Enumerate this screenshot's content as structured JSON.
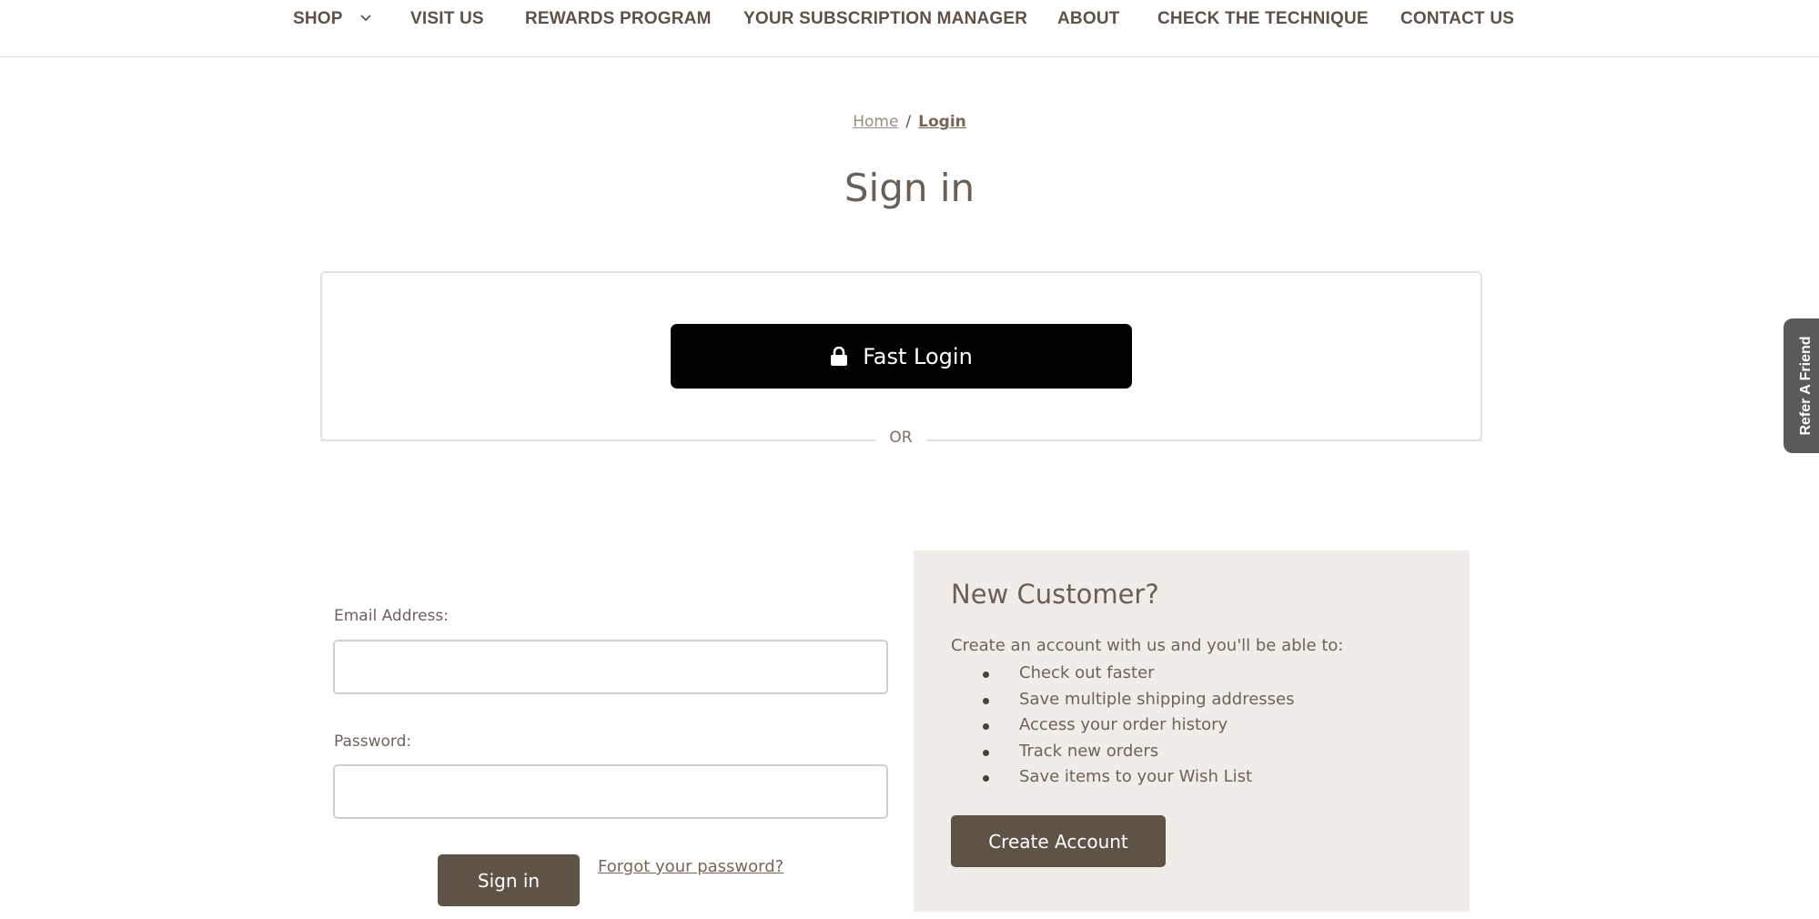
{
  "nav": {
    "items": [
      {
        "label": "SHOP"
      },
      {
        "label": "VISIT US"
      },
      {
        "label": "REWARDS PROGRAM"
      },
      {
        "label": "YOUR SUBSCRIPTION MANAGER"
      },
      {
        "label": "ABOUT"
      },
      {
        "label": "CHECK THE TECHNIQUE"
      },
      {
        "label": "CONTACT US"
      }
    ]
  },
  "breadcrumb": {
    "home": "Home",
    "separator": "/",
    "current": "Login"
  },
  "page": {
    "title": "Sign in"
  },
  "fast_login": {
    "button_label": "Fast Login",
    "divider_label": "OR"
  },
  "login_form": {
    "email_label": "Email Address:",
    "email_value": "",
    "password_label": "Password:",
    "password_value": "",
    "submit_label": "Sign in",
    "forgot_label": "Forgot your password?"
  },
  "new_customer": {
    "title": "New Customer?",
    "intro": "Create an account with us and you'll be able to:",
    "benefits": [
      "Check out faster",
      "Save multiple shipping addresses",
      "Access your order history",
      "Track new orders",
      "Save items to your Wish List"
    ],
    "button_label": "Create Account"
  },
  "refer_tab": {
    "label": "Refer A Friend"
  },
  "colors": {
    "primary_button": "#5e5347",
    "fast_login_button": "#000000",
    "panel_background": "#f0ece8",
    "refer_tab": "#5a5a5a"
  }
}
